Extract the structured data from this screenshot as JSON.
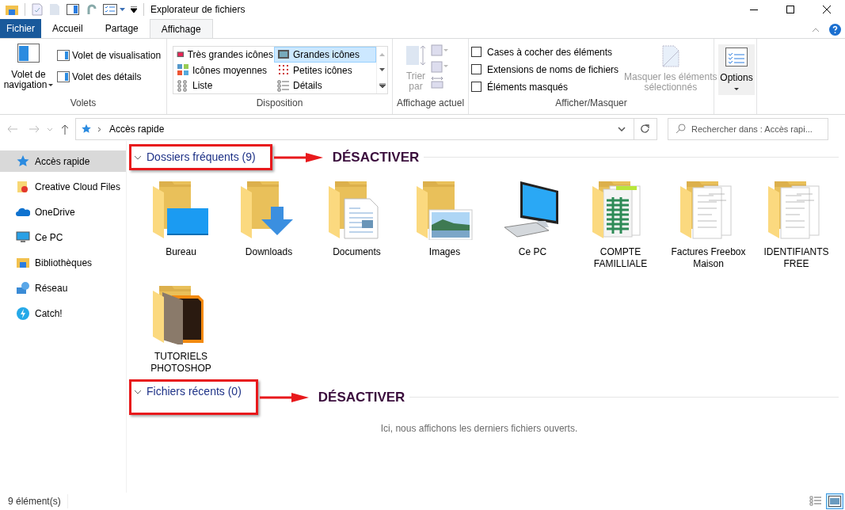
{
  "window": {
    "title": "Explorateur de fichiers"
  },
  "ribbon_tabs": [
    {
      "label": "Fichier",
      "kind": "file"
    },
    {
      "label": "Accueil",
      "kind": "tab",
      "selected": false
    },
    {
      "label": "Partage",
      "kind": "tab",
      "selected": false
    },
    {
      "label": "Affichage",
      "kind": "tab",
      "selected": true
    }
  ],
  "ribbon": {
    "panes": {
      "group": "Volets",
      "navigation_pane": [
        "Volet de",
        "navigation"
      ],
      "items": [
        "Volet de visualisation",
        "Volet des détails"
      ]
    },
    "layout": {
      "group": "Disposition",
      "options": [
        {
          "label": "Très grandes icônes",
          "selected": false
        },
        {
          "label": "Grandes icônes",
          "selected": true
        },
        {
          "label": "Icônes moyennes",
          "selected": false
        },
        {
          "label": "Petites icônes",
          "selected": false
        },
        {
          "label": "Liste",
          "selected": false
        },
        {
          "label": "Détails",
          "selected": false
        }
      ]
    },
    "current_view": {
      "group": "Affichage actuel",
      "sort": [
        "Trier",
        "par"
      ]
    },
    "show_hide": {
      "group": "Afficher/Masquer",
      "checkboxes": [
        {
          "label": "Cases à cocher des éléments",
          "checked": false
        },
        {
          "label": "Extensions de noms de fichiers",
          "checked": false
        },
        {
          "label": "Éléments masqués",
          "checked": false
        }
      ],
      "hide_selected": [
        "Masquer les éléments",
        "sélectionnés"
      ]
    },
    "options": "Options"
  },
  "address": {
    "location": "Accès rapide"
  },
  "search": {
    "placeholder": "Rechercher dans : Accès rapi..."
  },
  "sidebar": {
    "items": [
      {
        "label": "Accès rapide",
        "kind": "quick",
        "selected": true
      },
      {
        "label": "Creative Cloud Files",
        "kind": "creative",
        "selected": false
      },
      {
        "label": "OneDrive",
        "kind": "onedrive",
        "selected": false
      },
      {
        "label": "Ce PC",
        "kind": "pc",
        "selected": false
      },
      {
        "label": "Bibliothèques",
        "kind": "library",
        "selected": false
      },
      {
        "label": "Réseau",
        "kind": "network",
        "selected": false
      },
      {
        "label": "Catch!",
        "kind": "catch",
        "selected": false
      }
    ]
  },
  "sections": [
    {
      "title": "Dossiers fréquents (9)",
      "annotation": "DÉSACTIVER",
      "items": [
        {
          "name": [
            "Bureau"
          ],
          "kind": "desktop"
        },
        {
          "name": [
            "Downloads"
          ],
          "kind": "download"
        },
        {
          "name": [
            "Documents"
          ],
          "kind": "document"
        },
        {
          "name": [
            "Images"
          ],
          "kind": "image"
        },
        {
          "name": [
            "Ce PC"
          ],
          "kind": "pc"
        },
        {
          "name": [
            "COMPTE",
            "FAMILLIALE"
          ],
          "kind": "sheet"
        },
        {
          "name": [
            "Factures Freebox",
            "Maison"
          ],
          "kind": "papers"
        },
        {
          "name": [
            "IDENTIFIANTS",
            "FREE"
          ],
          "kind": "papers"
        },
        {
          "name": [
            "TUTORIELS",
            "PHOTOSHOP"
          ],
          "kind": "photo"
        }
      ]
    },
    {
      "title": "Fichiers récents (0)",
      "annotation": "DÉSACTIVER",
      "empty_message": "Ici, nous affichons les derniers fichiers ouverts."
    }
  ],
  "status_bar": {
    "count": "9 élément(s)",
    "view_buttons": [
      {
        "kind": "details",
        "selected": false
      },
      {
        "kind": "large",
        "selected": true
      }
    ]
  }
}
